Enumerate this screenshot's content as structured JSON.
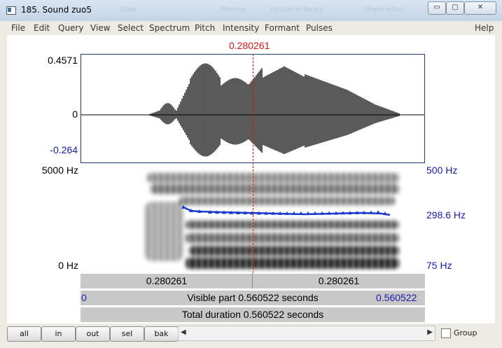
{
  "window": {
    "title": "185. Sound zuo5",
    "bg_titles": [
      "Draw",
      "Process",
      "Include in library",
      "Shape editor"
    ]
  },
  "window_controls": {
    "minimize": "▭",
    "maximize": "▢",
    "close": "✕"
  },
  "menu": [
    "File",
    "Edit",
    "Query",
    "View",
    "Select",
    "Spectrum",
    "Pitch",
    "Intensity",
    "Formant",
    "Pulses",
    "Help"
  ],
  "cursor": {
    "time": "0.280261"
  },
  "waveform": {
    "max_label": "0.4571",
    "zero_label": "0",
    "min_label": "-0.264"
  },
  "spectrogram": {
    "top_left": "5000 Hz",
    "bottom_left": "0 Hz",
    "top_right": "500 Hz",
    "pitch_right": "298.6 Hz",
    "bottom_right": "75 Hz"
  },
  "time_bar": {
    "left": "0.280261",
    "right": "0.280261"
  },
  "visible_bar": {
    "start": "0",
    "label": "Visible part 0.560522 seconds",
    "end": "0.560522"
  },
  "total_bar": {
    "label": "Total duration 0.560522 seconds"
  },
  "buttons": {
    "all": "all",
    "in": "in",
    "out": "out",
    "sel": "sel",
    "bak": "bak"
  },
  "scroll": {
    "left_arrow": "◀",
    "right_arrow": "▶"
  },
  "group": {
    "label": "Group"
  },
  "colors": {
    "cursor": "#d01818",
    "pitch": "#1a1aa8",
    "frame": "#1f3a72"
  }
}
